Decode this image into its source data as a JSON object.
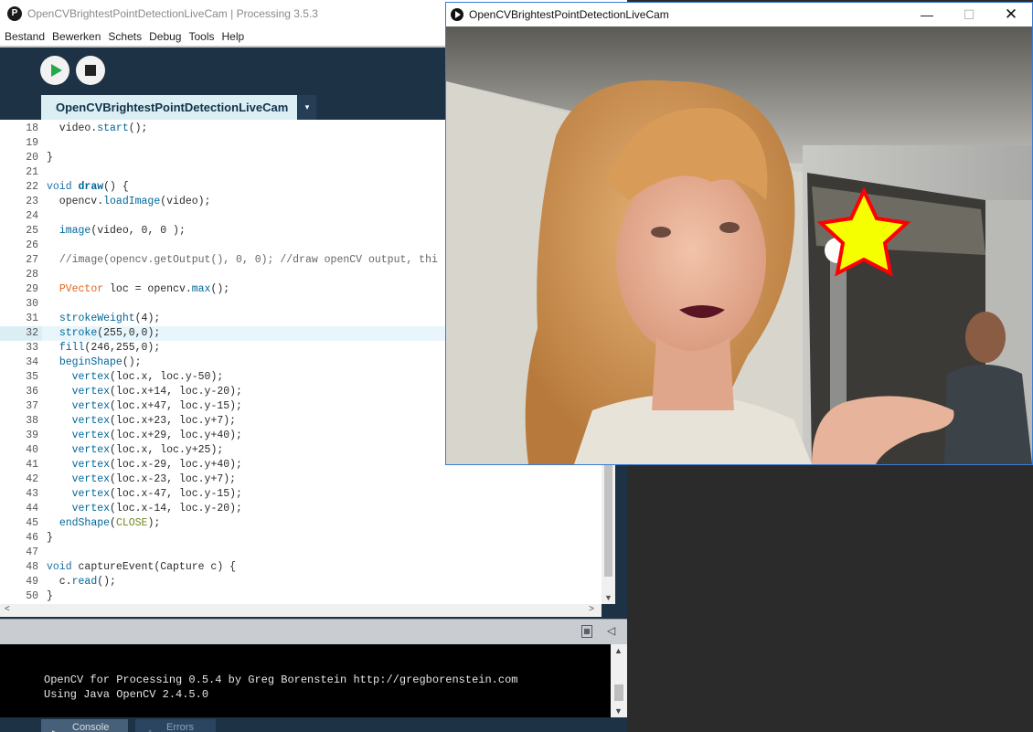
{
  "ide": {
    "title": "OpenCVBrightestPointDetectionLiveCam | Processing 3.5.3",
    "menu": [
      "Bestand",
      "Bewerken",
      "Schets",
      "Debug",
      "Tools",
      "Help"
    ],
    "toolbar": {
      "run_icon": "play-icon",
      "stop_icon": "stop-icon"
    },
    "tab": {
      "label": "OpenCVBrightestPointDetectionLiveCam",
      "menu_icon": "▾"
    },
    "highlighted_line": 32,
    "code_lines": [
      {
        "n": "18",
        "text": "  video.start();"
      },
      {
        "n": "19",
        "text": ""
      },
      {
        "n": "20",
        "text": "}"
      },
      {
        "n": "21",
        "text": ""
      },
      {
        "n": "22",
        "text": "void draw() {"
      },
      {
        "n": "23",
        "text": "  opencv.loadImage(video);"
      },
      {
        "n": "24",
        "text": ""
      },
      {
        "n": "25",
        "text": "  image(video, 0, 0 );"
      },
      {
        "n": "26",
        "text": ""
      },
      {
        "n": "27",
        "text": "  //image(opencv.getOutput(), 0, 0); //draw openCV output, thi"
      },
      {
        "n": "28",
        "text": ""
      },
      {
        "n": "29",
        "text": "  PVector loc = opencv.max();"
      },
      {
        "n": "30",
        "text": ""
      },
      {
        "n": "31",
        "text": "  strokeWeight(4);"
      },
      {
        "n": "32",
        "text": "  stroke(255,0,0);"
      },
      {
        "n": "33",
        "text": "  fill(246,255,0);"
      },
      {
        "n": "34",
        "text": "  beginShape();"
      },
      {
        "n": "35",
        "text": "    vertex(loc.x, loc.y-50);"
      },
      {
        "n": "36",
        "text": "    vertex(loc.x+14, loc.y-20);"
      },
      {
        "n": "37",
        "text": "    vertex(loc.x+47, loc.y-15);"
      },
      {
        "n": "38",
        "text": "    vertex(loc.x+23, loc.y+7);"
      },
      {
        "n": "39",
        "text": "    vertex(loc.x+29, loc.y+40);"
      },
      {
        "n": "40",
        "text": "    vertex(loc.x, loc.y+25);"
      },
      {
        "n": "41",
        "text": "    vertex(loc.x-29, loc.y+40);"
      },
      {
        "n": "42",
        "text": "    vertex(loc.x-23, loc.y+7);"
      },
      {
        "n": "43",
        "text": "    vertex(loc.x-47, loc.y-15);"
      },
      {
        "n": "44",
        "text": "    vertex(loc.x-14, loc.y-20);"
      },
      {
        "n": "45",
        "text": "  endShape(CLOSE);"
      },
      {
        "n": "46",
        "text": "}"
      },
      {
        "n": "47",
        "text": ""
      },
      {
        "n": "48",
        "text": "void captureEvent(Capture c) {"
      },
      {
        "n": "49",
        "text": "  c.read();"
      },
      {
        "n": "50",
        "text": "}"
      }
    ],
    "console_lines": [
      "OpenCV for Processing 0.5.4 by Greg Borenstein http://gregborenstein.com",
      "Using Java OpenCV 2.4.5.0"
    ],
    "bottom_tabs": [
      {
        "label": "Console",
        "icon": "console-icon"
      },
      {
        "label": "Errors",
        "icon": "warning-icon"
      }
    ]
  },
  "sketch_window": {
    "title": "OpenCVBrightestPointDetectionLiveCam",
    "controls": {
      "minimize": "—",
      "maximize": "☐",
      "close": "✕"
    },
    "star": {
      "fill": "#f6ff00",
      "stroke": "#ff0000"
    }
  },
  "colors": {
    "ide_dark": "#1d3245",
    "tab_active": "#dbeef3",
    "run_green": "#23a84a"
  }
}
